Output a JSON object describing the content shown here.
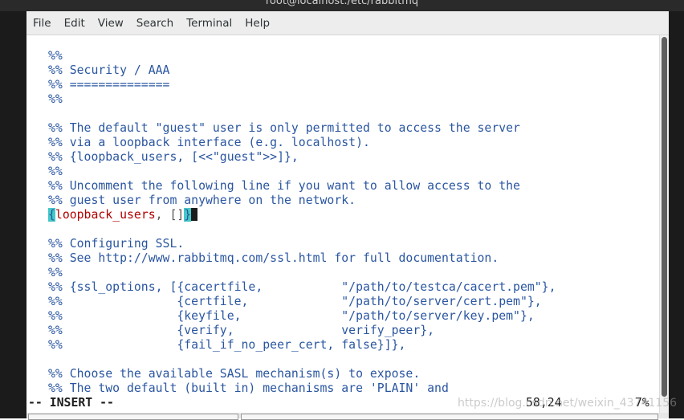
{
  "window": {
    "title": "root@localhost:/etc/rabbitmq"
  },
  "menu": [
    "File",
    "Edit",
    "View",
    "Search",
    "Terminal",
    "Help"
  ],
  "editor": {
    "lines": [
      "%%",
      "%% Security / AAA",
      "%% ==============",
      "%%",
      "",
      "%% The default \"guest\" user is only permitted to access the server",
      "%% via a loopback interface (e.g. localhost).",
      "%% {loopback_users, [<<\"guest\">>]},",
      "%%",
      "%% Uncomment the following line if you want to allow access to the",
      "%% guest user from anywhere on the network.",
      "__CURSOR_LINE__",
      "",
      "%% Configuring SSL.",
      "%% See http://www.rabbitmq.com/ssl.html for full documentation.",
      "%%",
      "%% {ssl_options, [{cacertfile,           \"/path/to/testca/cacert.pem\"},",
      "%%                {certfile,             \"/path/to/server/cert.pem\"},",
      "%%                {keyfile,              \"/path/to/server/key.pem\"},",
      "%%                {verify,               verify_peer},",
      "%%                {fail_if_no_peer_cert, false}]},",
      "",
      "%% Choose the available SASL mechanism(s) to expose.",
      "%% The two default (built in) mechanisms are 'PLAIN' and"
    ],
    "cursor_line": {
      "open_brace": "{",
      "key": "loopback_users",
      "rest": ", []",
      "close_brace": "}"
    }
  },
  "status": {
    "mode": "-- INSERT --",
    "position": "58,24",
    "percent": "7%"
  },
  "watermark": "https://blog.csdn.net/weixin_43741156"
}
